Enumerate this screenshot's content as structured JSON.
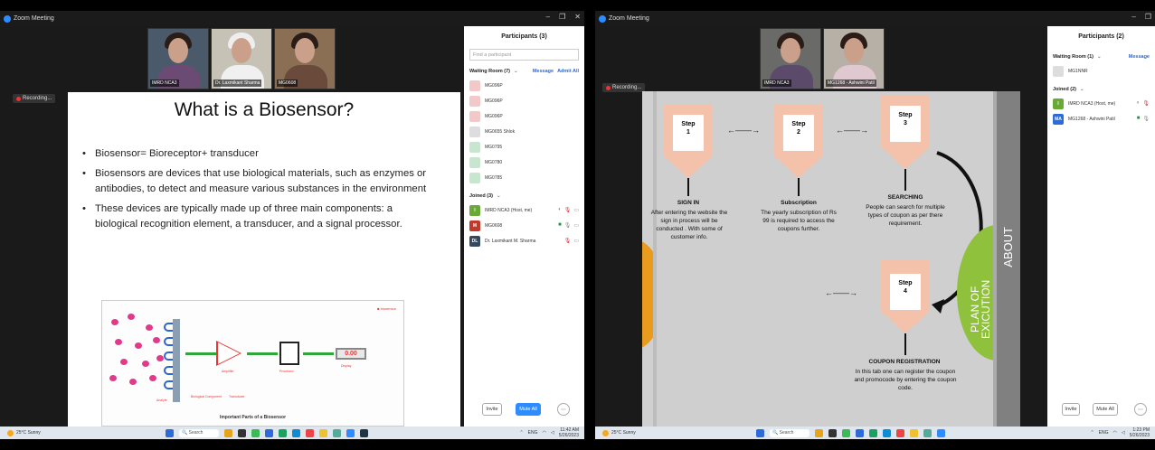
{
  "left": {
    "window_title": "Zoom Meeting",
    "tiles": [
      "IMRD NCA3",
      "Dr. Laxmikant Sharma",
      "MG0608"
    ],
    "recording": "Recording...",
    "slide": {
      "title": "What is a Biosensor?",
      "bullets": [
        "Biosensor= Bioreceptor+ transducer",
        "Biosensors are devices that use biological materials, such as enzymes or antibodies, to detect and measure various substances in the environment",
        "These devices are typically made up of three main components: a biological recognition element, a transducer, and a signal processor."
      ],
      "diagram_display": "0.00",
      "diagram_caption": "Important Parts of a Biosensor",
      "diagram_labels": [
        "Analyte",
        "Biological Component",
        "Transducer",
        "Amplifier",
        "Processor",
        "Display"
      ]
    },
    "participants": {
      "title": "Participants (3)",
      "search_placeholder": "Find a participant",
      "waiting": "Waiting Room (7)",
      "message": "Message",
      "admit_all": "Admit All",
      "waiting_list": [
        "MG096P",
        "MG096P",
        "MG096P",
        "MG0655 Shlok",
        "MG0795",
        "MG0780",
        "MG0785"
      ],
      "joined": "Joined (3)",
      "joined_list": [
        {
          "initials": "I",
          "name": "IMRD NCA3 (Host, me)",
          "color": "#6aa936"
        },
        {
          "initials": "M",
          "name": "MG0608",
          "color": "#c0392b"
        },
        {
          "initials": "DL",
          "name": "Dr. Laxmikant M. Sharma",
          "color": "#34495e"
        }
      ],
      "invite": "Invite",
      "mute_all": "Mute All"
    },
    "taskbar": {
      "temp": "25°C",
      "cond": "Sunny",
      "search": "Search",
      "lang": "ENG",
      "time": "11:42 AM",
      "date": "5/26/2023"
    }
  },
  "right": {
    "window_title": "Zoom Meeting",
    "tiles": [
      "IMRD NCA3",
      "MG1268 - Ashwini Patil"
    ],
    "recording": "Recording...",
    "slide": {
      "steps": [
        {
          "label": "Step\n1",
          "title": "SIGN IN",
          "desc": "After entering the website the sign in process will be conducted . With some of customer info."
        },
        {
          "label": "Step\n2",
          "title": "Subscription",
          "desc": "The yearly subscription of Rs 99 is required to access the coupons further."
        },
        {
          "label": "Step\n3",
          "title": "SEARCHING",
          "desc": "People can search for multiple types of coupon as per there requirement."
        },
        {
          "label": "Step\n4",
          "title": "COUPON REGISTRATION",
          "desc": "In this tab one can register the coupon and promocode by entering the coupon code."
        }
      ],
      "plan_label": "PLAN OF EXICUTION",
      "about_label": "ABOUT"
    },
    "participants": {
      "title": "Participants (2)",
      "waiting": "Waiting Room (1)",
      "message": "Message",
      "waiting_list": [
        "MG1NNR"
      ],
      "joined": "Joined (2)",
      "joined_list": [
        {
          "initials": "I",
          "name": "IMRD NCA3 (Host, me)",
          "color": "#6aa936"
        },
        {
          "initials": "MA",
          "name": "MG1268 - Ashwini Patil",
          "color": "#2d6bd8"
        }
      ],
      "invite": "Invite",
      "mute_all": "Mute All"
    },
    "taskbar": {
      "temp": "25°C",
      "cond": "Sunny",
      "search": "Search",
      "lang": "ENG",
      "time": "1:23 PM",
      "date": "5/26/2023"
    }
  }
}
